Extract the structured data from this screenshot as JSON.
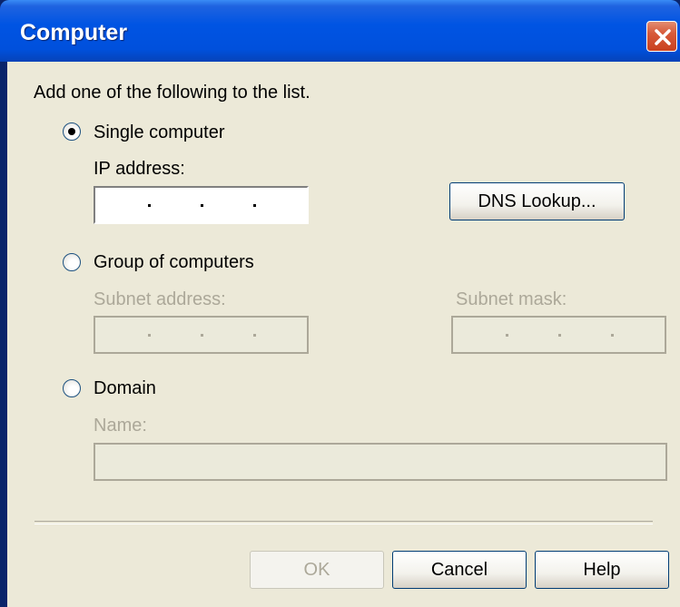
{
  "window": {
    "title": "Computer"
  },
  "prompt": "Add one of the following to the list.",
  "single": {
    "radio_label": "Single computer",
    "ip_label": "IP address:",
    "ip_value": "",
    "dns_button": "DNS Lookup..."
  },
  "group": {
    "radio_label": "Group of computers",
    "subnet_address_label": "Subnet address:",
    "subnet_address_value": "",
    "subnet_mask_label": "Subnet mask:",
    "subnet_mask_value": ""
  },
  "domain": {
    "radio_label": "Domain",
    "name_label": "Name:",
    "name_value": ""
  },
  "buttons": {
    "ok": "OK",
    "cancel": "Cancel",
    "help": "Help"
  },
  "selected_option": "Single computer",
  "icons": {
    "close": "close-icon"
  },
  "colors": {
    "titlebar": "#0054e3",
    "dialog": "#ece9d8",
    "disabled_text": "#aca899",
    "close": "#d75a3a"
  }
}
